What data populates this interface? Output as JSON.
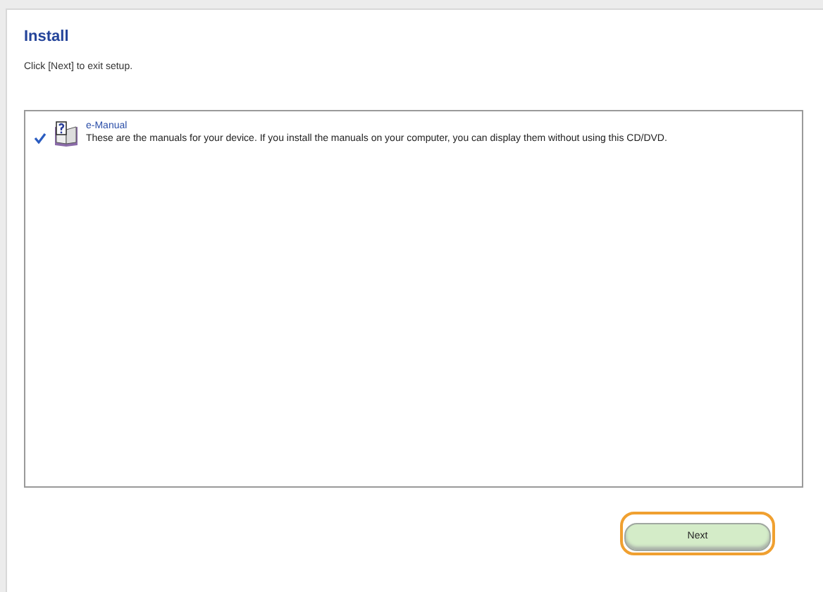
{
  "title": "Install",
  "instruction": "Click [Next] to exit setup.",
  "items": [
    {
      "name": "e-Manual",
      "description": "These are the manuals for your device. If you install the manuals on your computer, you can display them without using this CD/DVD.",
      "checked": true
    }
  ],
  "next_button": {
    "label": "Next",
    "focused": true
  }
}
